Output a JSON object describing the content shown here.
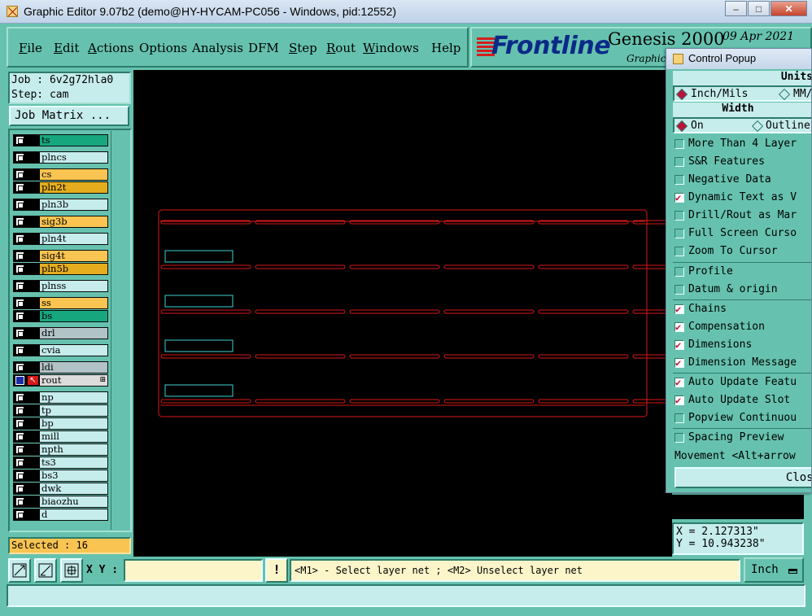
{
  "window": {
    "title": "Graphic Editor 9.07b2 (demo@HY-HYCAM-PC056 - Windows, pid:12552)",
    "minimize": "–",
    "maximize": "□",
    "close": "✕"
  },
  "menu": {
    "file": "File",
    "edit": "Edit",
    "actions": "Actions",
    "options": "Options",
    "analysis": "Analysis",
    "dfm": "DFM",
    "step": "Step",
    "rout": "Rout",
    "windows": "Windows",
    "help": "Help"
  },
  "logo": {
    "brand": "Frontline",
    "product": "Genesis 2000",
    "date": "09 Apr 2021",
    "subtitle": "Graphic"
  },
  "job": {
    "job_line": "Job : 6v2g72hla0",
    "step_line": "Step: cam",
    "matrix_button": "Job Matrix ..."
  },
  "layers": [
    {
      "name": "ts",
      "color": "#17a77e"
    },
    {
      "name": "plncs",
      "color": "#c6ecec"
    },
    {
      "name": "cs",
      "color": "#f9c451"
    },
    {
      "name": "pln2t",
      "color": "#e5ad1e"
    },
    {
      "name": "pln3b",
      "color": "#c6ecec"
    },
    {
      "name": "sig3b",
      "color": "#f9c451"
    },
    {
      "name": "pln4t",
      "color": "#c6ecec"
    },
    {
      "name": "sig4t",
      "color": "#f9c451"
    },
    {
      "name": "pln5b",
      "color": "#e5ad1e"
    },
    {
      "name": "plnss",
      "color": "#c6ecec"
    },
    {
      "name": "ss",
      "color": "#f9c451"
    },
    {
      "name": "bs",
      "color": "#17a77e"
    },
    {
      "name": "drl",
      "color": "#b1c3c6"
    },
    {
      "name": "cvia",
      "color": "#c6ecec"
    },
    {
      "name": "ldi",
      "color": "#b1c3c6"
    },
    {
      "name": "rout",
      "color": "#dcdcdc"
    },
    {
      "name": "np",
      "color": "#c6ecec"
    },
    {
      "name": "tp",
      "color": "#c6ecec"
    },
    {
      "name": "bp",
      "color": "#c6ecec"
    },
    {
      "name": "mill",
      "color": "#c6ecec"
    },
    {
      "name": "npth",
      "color": "#c6ecec"
    },
    {
      "name": "ts3",
      "color": "#c6ecec"
    },
    {
      "name": "bs3",
      "color": "#c6ecec"
    },
    {
      "name": "dwk",
      "color": "#c6ecec"
    },
    {
      "name": "biaozhu",
      "color": "#c6ecec"
    },
    {
      "name": "d",
      "color": "#c6ecec"
    }
  ],
  "selected_count": "Selected : 16",
  "bottom": {
    "xy_label": "X Y :",
    "xy_value": "",
    "excl": "!",
    "status": "<M1> - Select layer net ; <M2> Unselect layer net",
    "units": "Inch"
  },
  "coords": {
    "x": "X = 2.127313\"",
    "y": "Y = 10.943238\""
  },
  "popup": {
    "title": "Control Popup",
    "units_header": "Units",
    "unit_inch": "Inch/Mils",
    "unit_mm": "MM/",
    "width_header": "Width",
    "width_on": "On",
    "width_outline": "Outline",
    "options": [
      {
        "label": "More Than 4 Layer",
        "checked": false
      },
      {
        "label": "S&R Features",
        "checked": false
      },
      {
        "label": "Negative Data",
        "checked": false
      },
      {
        "label": "Dynamic Text as V",
        "checked": true
      },
      {
        "label": "Drill/Rout as Mar",
        "checked": false
      },
      {
        "label": "Full Screen Curso",
        "checked": false
      },
      {
        "label": "Zoom To Cursor",
        "checked": false
      }
    ],
    "options2": [
      {
        "label": "Profile",
        "checked": false
      },
      {
        "label": "Datum & origin",
        "checked": false
      }
    ],
    "options3": [
      {
        "label": "Chains",
        "checked": true
      },
      {
        "label": "Compensation",
        "checked": true
      },
      {
        "label": "Dimensions",
        "checked": true
      },
      {
        "label": "Dimension Message",
        "checked": true
      }
    ],
    "options4": [
      {
        "label": "Auto Update Featu",
        "checked": true
      },
      {
        "label": "Auto Update Slot",
        "checked": true
      },
      {
        "label": "Popview Continuou",
        "checked": false
      }
    ],
    "spacing": "Spacing Preview",
    "movement": "Movement <Alt+arrow",
    "close": "Close"
  }
}
